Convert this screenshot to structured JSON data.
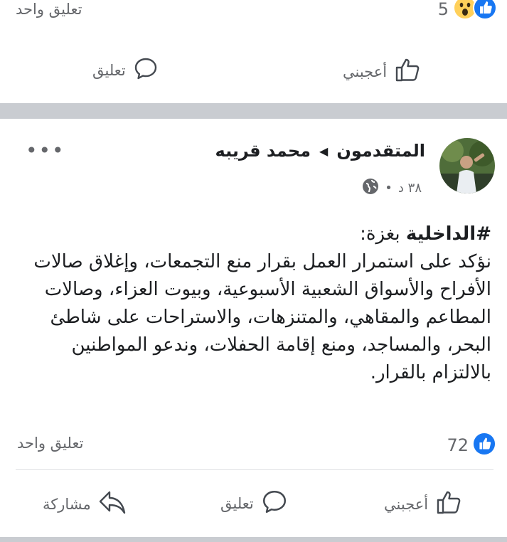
{
  "prev_post": {
    "reactions_count": "5",
    "comments_count": "تعليق واحد",
    "like_label": "أعجبني",
    "comment_label": "تعليق"
  },
  "post": {
    "group": "المتقدمون",
    "author": "محمد قريبه",
    "time": "٣٨ د",
    "hashtag": "#الداخلية",
    "body_title_rest": " بغزة:",
    "body": "نؤكد على استمرار العمل بقرار منع التجمعات، وإغلاق صالات الأفراح والأسواق الشعبية الأسبوعية، وبيوت العزاء، وصالات المطاعم والمقاهي، والمتنزهات، والاستراحات على شاطئ البحر، والمساجد، ومنع إقامة الحفلات، وندعو المواطنين بالالتزام بالقرار.",
    "reactions_count": "72",
    "comments_count": "تعليق واحد",
    "like_label": "أعجبني",
    "comment_label": "تعليق",
    "share_label": "مشاركة"
  },
  "colors": {
    "like_blue": "#1877f2",
    "muted": "#65676b",
    "separator": "#c9ccd1"
  },
  "icons": [
    "like-reaction-icon",
    "wow-reaction-icon",
    "thumbs-up-icon",
    "comment-bubble-icon",
    "share-arrow-icon",
    "globe-icon",
    "more-dots-icon"
  ]
}
